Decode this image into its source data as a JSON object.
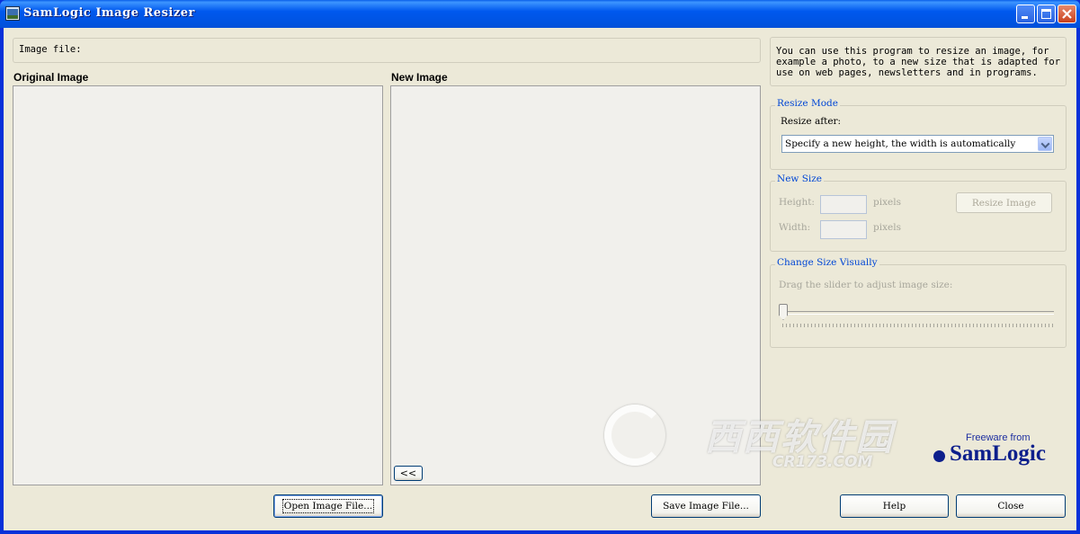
{
  "window": {
    "title": "SamLogic Image Resizer"
  },
  "image_file": {
    "label": "Image file:",
    "value": ""
  },
  "panels": {
    "original_label": "Original Image",
    "new_label": "New Image",
    "nav_label": "<<"
  },
  "buttons": {
    "open": "Open Image File...",
    "save": "Save Image File...",
    "help": "Help",
    "close": "Close",
    "resize": "Resize Image"
  },
  "info": {
    "line1": "You can use this program to resize an image, for",
    "line2": "example a photo, to a new size that is adapted for",
    "line3": "use on web pages, newsletters and in programs."
  },
  "resize_mode": {
    "title": "Resize Mode",
    "label": "Resize after:",
    "selected": "Specify a new height, the width is automatically"
  },
  "new_size": {
    "title": "New Size",
    "height_label": "Height:",
    "width_label": "Width:",
    "unit": "pixels",
    "height_value": "",
    "width_value": ""
  },
  "visual": {
    "title": "Change Size Visually",
    "hint": "Drag the slider to adjust image size:",
    "slider_value": 0
  },
  "branding": {
    "freeware": "Freeware from",
    "company": "SamLogic"
  },
  "watermark": {
    "text": "西西软件园",
    "sub": "CR173.COM"
  }
}
